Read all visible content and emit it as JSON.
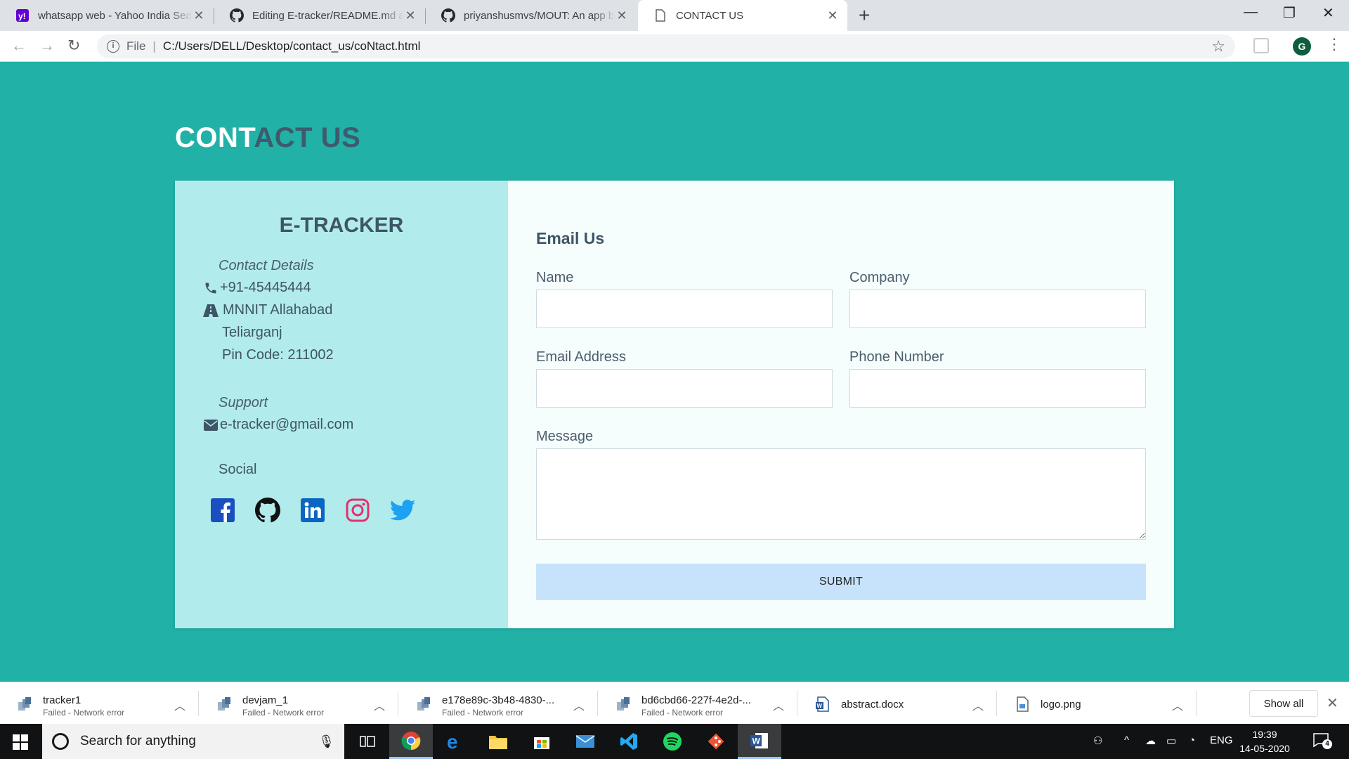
{
  "browser": {
    "tabs": [
      {
        "title": "whatsapp web - Yahoo India Search",
        "favicon": "yahoo-icon",
        "active": false
      },
      {
        "title": "Editing E-tracker/README.md at master",
        "favicon": "github-icon",
        "active": false
      },
      {
        "title": "priyanshusmvs/MOUT: An app based",
        "favicon": "github-icon",
        "active": false
      },
      {
        "title": "CONTACT US",
        "favicon": "page-icon",
        "active": true
      }
    ],
    "address": {
      "scheme_label": "File",
      "url": "C:/Users/DELL/Desktop/contact_us/coNtact.html"
    },
    "profile_initial": "G"
  },
  "page": {
    "title_light": "CONT",
    "title_dark": "ACT US",
    "brand": "E-TRACKER",
    "contact_heading": "Contact Details",
    "phone": "+91-45445444",
    "address_line1": "MNNIT Allahabad",
    "address_line2": "Teliarganj",
    "address_line3": "Pin Code: 211002",
    "support_heading": "Support",
    "email": "e-tracker@gmail.com",
    "social_heading": "Social",
    "social_icons": [
      "facebook-icon",
      "github-icon",
      "linkedin-icon",
      "instagram-icon",
      "twitter-icon"
    ],
    "form": {
      "heading": "Email Us",
      "name_label": "Name",
      "name_value": "",
      "company_label": "Company",
      "company_value": "",
      "email_label": "Email Address",
      "email_value": "",
      "phone_label": "Phone Number",
      "phone_value": "",
      "message_label": "Message",
      "message_value": "",
      "submit_label": "SUBMIT"
    },
    "colors": {
      "background": "#21b1a7",
      "left_panel": "#b2ebeb",
      "submit_button": "#c7e3fb",
      "title_dark": "#3e5b6d"
    }
  },
  "downloads": {
    "items": [
      {
        "name": "tracker1",
        "status": "Failed - Network error",
        "icon": "archive-icon"
      },
      {
        "name": "devjam_1",
        "status": "Failed - Network error",
        "icon": "archive-icon"
      },
      {
        "name": "e178e89c-3b48-4830-...",
        "status": "Failed - Network error",
        "icon": "archive-icon"
      },
      {
        "name": "bd6cbd66-227f-4e2d-...",
        "status": "Failed - Network error",
        "icon": "archive-icon"
      },
      {
        "name": "abstract.docx",
        "status": "",
        "icon": "word-doc-icon"
      },
      {
        "name": "logo.png",
        "status": "",
        "icon": "image-file-icon"
      }
    ],
    "show_all_label": "Show all"
  },
  "taskbar": {
    "search_placeholder": "Search for anything",
    "language": "ENG",
    "time": "19:39",
    "date": "14-05-2020",
    "notification_count": "4"
  }
}
